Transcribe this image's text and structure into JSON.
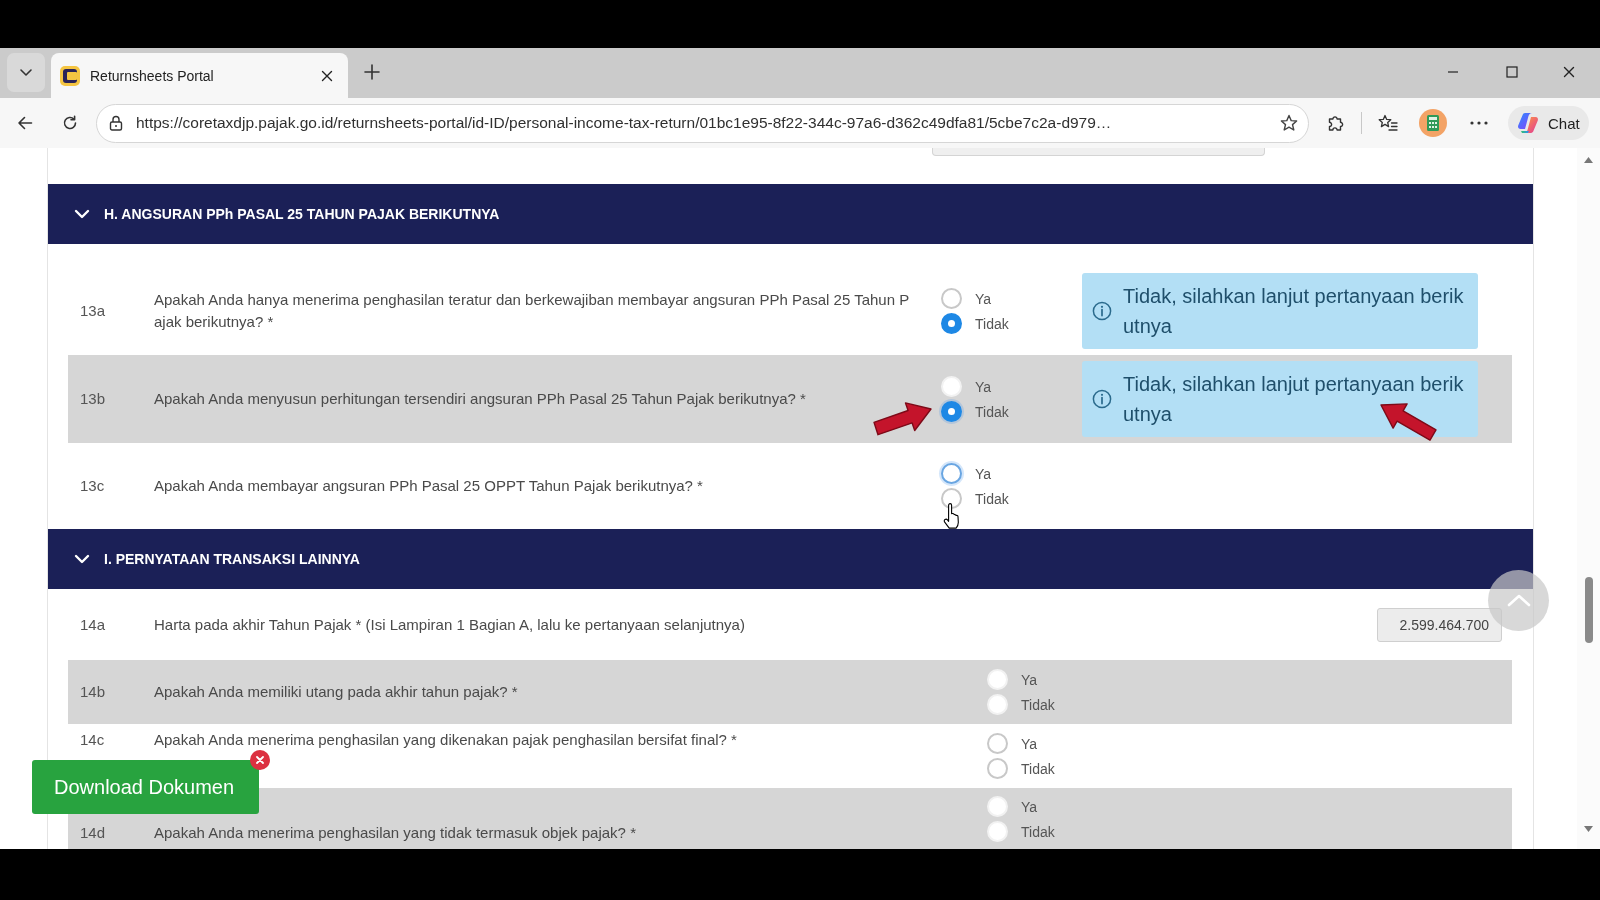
{
  "browser": {
    "tab": {
      "title": "Returnsheets Portal"
    },
    "url": "https://coretaxdjp.pajak.go.id/returnsheets-portal/id-ID/personal-income-tax-return/01bc1e95-8f22-344c-97a6-d362c49dfa81/5cbe7c2a-d979…",
    "chat_button": {
      "label": "Chat"
    }
  },
  "page": {
    "field_above": {
      "kind": "input"
    },
    "sections": [
      {
        "title": "H. ANGSURAN PPh PASAL 25 TAHUN PAJAK BERIKUTNYA",
        "expanded": true,
        "questions": [
          {
            "number": "13a",
            "text": "Apakah Anda hanya menerima penghasilan teratur dan berkewajiban membayar angsuran PPh Pasal 25 Tahun Pajak berikutnya? *",
            "kind": "choice",
            "annotated": false,
            "options": [
              {
                "label": "Ya",
                "selected": false,
                "focused": false,
                "hovered": false
              },
              {
                "label": "Tidak",
                "selected": true,
                "focused": false,
                "hovered": false
              }
            ],
            "notice": "Tidak, silahkan lanjut pertanyaan berikutnya"
          },
          {
            "number": "13b",
            "text": "Apakah Anda menyusun perhitungan tersendiri angsuran PPh Pasal 25 Tahun Pajak berikutnya? *",
            "kind": "choice",
            "annotated": true,
            "options": [
              {
                "label": "Ya",
                "selected": false,
                "focused": false,
                "hovered": false
              },
              {
                "label": "Tidak",
                "selected": true,
                "focused": true,
                "hovered": false
              }
            ],
            "notice": "Tidak, silahkan lanjut pertanyaan berikutnya"
          },
          {
            "number": "13c",
            "text": "Apakah Anda membayar angsuran PPh Pasal 25 OPPT Tahun Pajak berikutnya? *",
            "kind": "choice",
            "annotated": false,
            "options": [
              {
                "label": "Ya",
                "selected": false,
                "focused": true,
                "hovered": false
              },
              {
                "label": "Tidak",
                "selected": false,
                "focused": false,
                "hovered": true
              }
            ]
          }
        ]
      },
      {
        "title": "I. PERNYATAAN TRANSAKSI LAINNYA",
        "expanded": true,
        "questions": [
          {
            "number": "14a",
            "text": "Harta pada akhir Tahun Pajak * (Isi Lampiran 1 Bagian A, lalu ke pertanyaan selanjutnya)",
            "kind": "amount",
            "annotated": false,
            "value": "2.599.464.700"
          },
          {
            "number": "14b",
            "text": "Apakah Anda memiliki utang pada akhir tahun pajak? *",
            "kind": "choice",
            "annotated": false,
            "options": [
              {
                "label": "Ya",
                "selected": false,
                "focused": false,
                "hovered": false
              },
              {
                "label": "Tidak",
                "selected": false,
                "focused": false,
                "hovered": false
              }
            ]
          },
          {
            "number": "14c",
            "text": "Apakah Anda menerima penghasilan yang dikenakan pajak penghasilan bersifat final? *",
            "kind": "choice",
            "annotated": false,
            "options": [
              {
                "label": "Ya",
                "selected": false,
                "focused": false,
                "hovered": false
              },
              {
                "label": "Tidak",
                "selected": false,
                "focused": false,
                "hovered": false
              }
            ]
          },
          {
            "number": "14d",
            "text": "Apakah Anda menerima penghasilan yang tidak termasuk objek pajak? *",
            "kind": "choice",
            "annotated": false,
            "options": [
              {
                "label": "Ya",
                "selected": false,
                "focused": false,
                "hovered": false
              },
              {
                "label": "Tidak",
                "selected": false,
                "focused": false,
                "hovered": false
              }
            ]
          }
        ]
      }
    ]
  },
  "download_button": {
    "label": "Download Dokumen",
    "dismissible": true
  }
}
